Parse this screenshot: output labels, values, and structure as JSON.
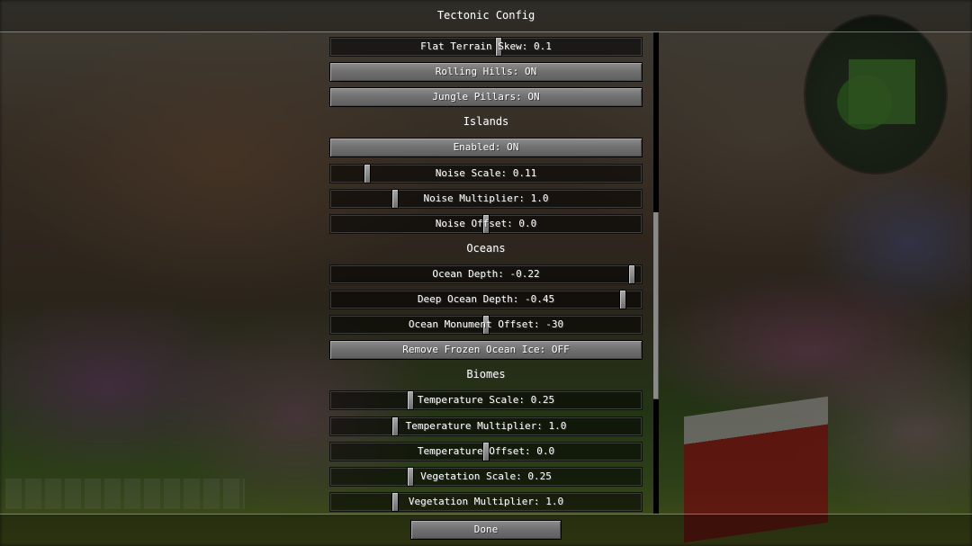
{
  "title": "Tectonic Config",
  "rows": [
    {
      "kind": "slider",
      "label": "Flat Terrain Skew: 0.1",
      "value": 0.54
    },
    {
      "kind": "button",
      "label": "Rolling Hills: ON"
    },
    {
      "kind": "button",
      "label": "Jungle Pillars: ON"
    },
    {
      "kind": "section",
      "label": "Islands"
    },
    {
      "kind": "button",
      "label": "Enabled: ON"
    },
    {
      "kind": "slider",
      "label": "Noise Scale: 0.11",
      "value": 0.11
    },
    {
      "kind": "slider",
      "label": "Noise Multiplier: 1.0",
      "value": 0.2
    },
    {
      "kind": "slider",
      "label": "Noise Offset: 0.0",
      "value": 0.5
    },
    {
      "kind": "section",
      "label": "Oceans"
    },
    {
      "kind": "slider",
      "label": "Ocean Depth: -0.22",
      "value": 0.98
    },
    {
      "kind": "slider",
      "label": "Deep Ocean Depth: -0.45",
      "value": 0.95
    },
    {
      "kind": "slider",
      "label": "Ocean Monument Offset: -30",
      "value": 0.5
    },
    {
      "kind": "button",
      "label": "Remove Frozen Ocean Ice: OFF"
    },
    {
      "kind": "section",
      "label": "Biomes"
    },
    {
      "kind": "slider",
      "label": "Temperature Scale: 0.25",
      "value": 0.25
    },
    {
      "kind": "slider",
      "label": "Temperature Multiplier: 1.0",
      "value": 0.2
    },
    {
      "kind": "slider",
      "label": "Temperature Offset: 0.0",
      "value": 0.5
    },
    {
      "kind": "slider",
      "label": "Vegetation Scale: 0.25",
      "value": 0.25
    },
    {
      "kind": "slider",
      "label": "Vegetation Multiplier: 1.0",
      "value": 0.2
    }
  ],
  "done_label": "Done",
  "scroll_position": 0.45
}
